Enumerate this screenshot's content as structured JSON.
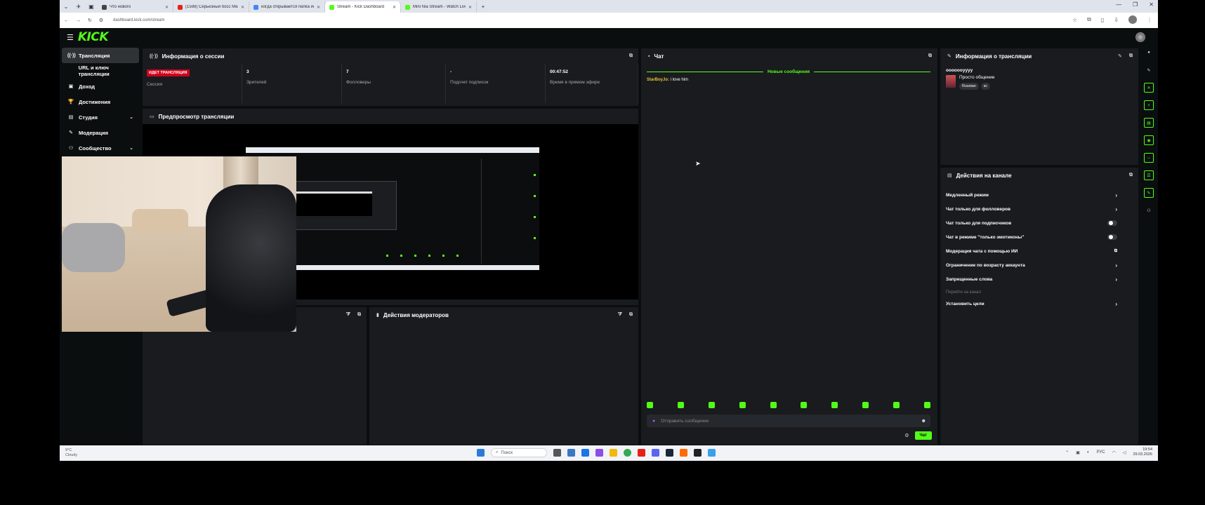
{
  "browser": {
    "tabs": [
      {
        "title": "Что нового",
        "color": "#444"
      },
      {
        "title": "(1598) Серьезный босс Мелл...",
        "color": "#e62117"
      },
      {
        "title": "когда открывается папка исп...",
        "color": "#4285f4"
      },
      {
        "title": "Stream - Kick Dashboard",
        "color": "#53fc18"
      },
      {
        "title": "Mini Nia Stream - Watch Live o...",
        "color": "#53fc18"
      }
    ],
    "url": "dashboard.kick.com/stream"
  },
  "sidebar": {
    "items": [
      {
        "label": "Трансляция",
        "icon": "broadcast-icon",
        "glyph": "((·))",
        "active": true,
        "chevron": false
      },
      {
        "label": "URL и ключ трансляции",
        "icon": "key-icon",
        "glyph": "",
        "active": false,
        "chevron": false
      },
      {
        "label": "Доход",
        "icon": "wallet-icon",
        "glyph": "▣",
        "active": false,
        "chevron": false
      },
      {
        "label": "Достижения",
        "icon": "trophy-icon",
        "glyph": "🏆",
        "active": false,
        "chevron": false
      },
      {
        "label": "Студия",
        "icon": "studio-icon",
        "glyph": "▤",
        "active": false,
        "chevron": true
      },
      {
        "label": "Модерация",
        "icon": "wrench-icon",
        "glyph": "✎",
        "active": false,
        "chevron": false
      },
      {
        "label": "Сообщество",
        "icon": "community-icon",
        "glyph": "⚇",
        "active": false,
        "chevron": true
      }
    ]
  },
  "session": {
    "title": "Информация о сессии",
    "stats": [
      {
        "value": "ИДЕТ ТРАНСЛЯЦИЯ",
        "label": "Сессия",
        "badge": true
      },
      {
        "value": "3",
        "label": "Зрителей",
        "badge": false
      },
      {
        "value": "7",
        "label": "Фолловеры",
        "badge": false
      },
      {
        "value": "-",
        "label": "Подсчет подписок",
        "badge": false
      },
      {
        "value": "00:47:52",
        "label": "Время в прямом эфире",
        "badge": false
      }
    ]
  },
  "preview": {
    "title": "Предпросмотр трансляции"
  },
  "moderators": {
    "title": "Действия модераторов"
  },
  "chat": {
    "title": "Чат",
    "new_messages": "Новые сообщения",
    "message_user": "StarBoyJo:",
    "message_text": "i love him",
    "input_placeholder": "Отправить сообщение",
    "send_label": "Чат"
  },
  "stream_info": {
    "title": "Информация о трансляции",
    "stream_title": "ooooooyyyy",
    "category": "Просто общение",
    "tags": [
      "Russian",
      "кс"
    ]
  },
  "channel_actions": {
    "title": "Действия на канале",
    "rows": [
      {
        "label": "Медленный режим",
        "control": "arrow"
      },
      {
        "label": "Чат только для фолловеров",
        "control": "arrow"
      },
      {
        "label": "Чат только для подписчиков",
        "control": "toggle"
      },
      {
        "label": "Чат в режиме \"только эмотиконы\"",
        "control": "toggle"
      },
      {
        "label": "Модерация чата с помощью ИИ",
        "control": "external"
      },
      {
        "label": "Ограничение по возрасту аккаунта",
        "control": "arrow"
      },
      {
        "label": "Запрещенные слова",
        "control": "arrow"
      }
    ],
    "goto_channel": "Перейти на канал",
    "set_goals": "Установить цели"
  },
  "taskbar": {
    "weather_temp": "9°C",
    "weather_desc": "Cloudy",
    "search": "Поиск",
    "lang": "РУС",
    "time": "19:54",
    "date": "29.03.2026"
  },
  "colors": {
    "accent": "#53fc18",
    "live": "#d0021b",
    "panel": "#191b1f",
    "bg": "#0b0e0f"
  }
}
